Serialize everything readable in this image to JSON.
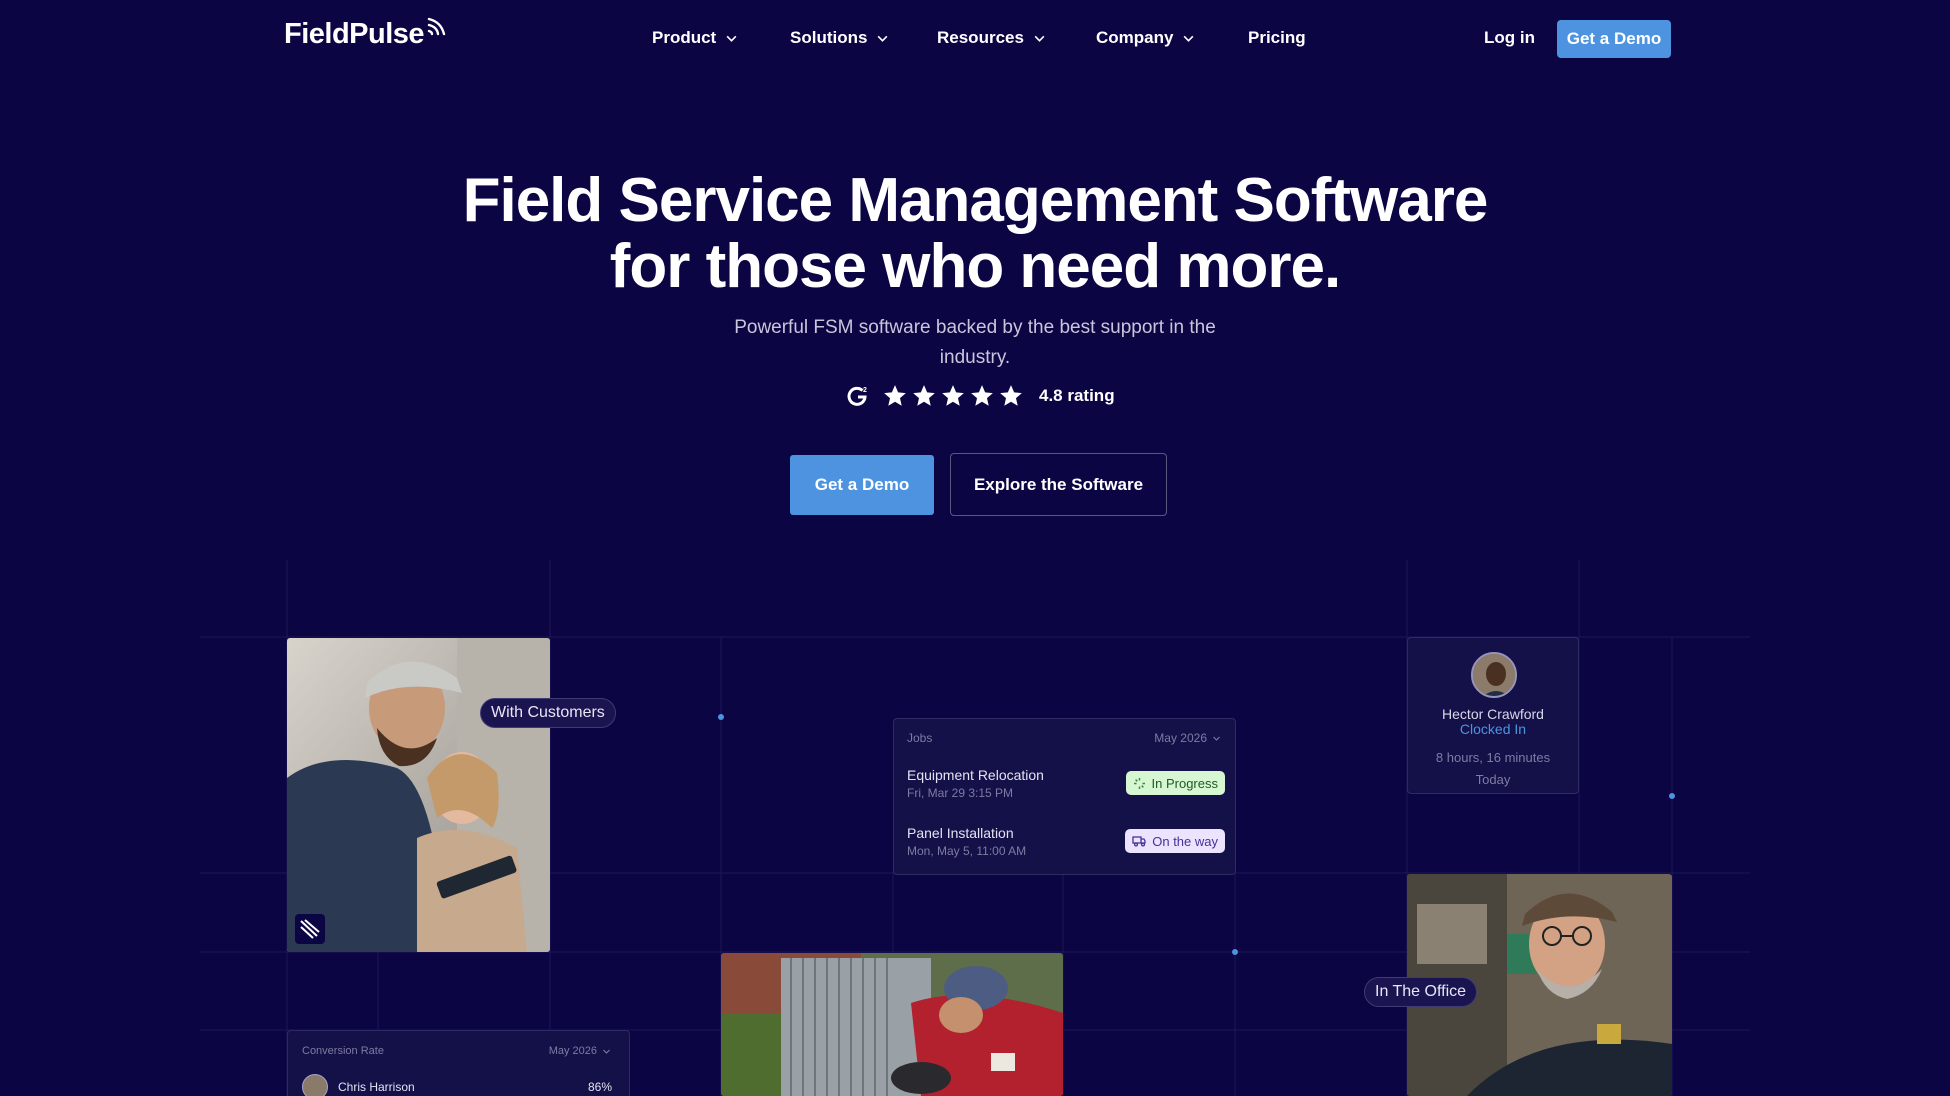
{
  "nav": {
    "logo": "FieldPulse",
    "items": [
      {
        "label": "Product",
        "has_dropdown": true
      },
      {
        "label": "Solutions",
        "has_dropdown": true
      },
      {
        "label": "Resources",
        "has_dropdown": true
      },
      {
        "label": "Company",
        "has_dropdown": true
      },
      {
        "label": "Pricing",
        "has_dropdown": false
      }
    ],
    "login": "Log in",
    "cta": "Get a Demo"
  },
  "hero": {
    "title_line1": "Field Service Management Software",
    "title_line2": "for those who need more.",
    "subtitle": "Powerful FSM software backed by the best support in the industry.",
    "rating_icon": "g2-icon",
    "stars": 5,
    "rating_text": "4.8 rating",
    "primary_cta": "Get a Demo",
    "secondary_cta": "Explore the Software"
  },
  "cards": {
    "with_customers": "With Customers",
    "in_office": "In The Office",
    "jobs": {
      "title": "Jobs",
      "period": "May 2026",
      "items": [
        {
          "title": "Equipment Relocation",
          "time": "Fri, Mar 29 3:15 PM",
          "status": "In Progress",
          "status_color": "#d7f6d2"
        },
        {
          "title": "Panel Installation",
          "time": "Mon, May 5, 11:00 AM",
          "status": "On the way",
          "status_color": "#ece3ff"
        }
      ]
    },
    "timeclock": {
      "name": "Hector Crawford",
      "status": "Clocked In",
      "duration": "8 hours, 16 minutes",
      "day": "Today"
    },
    "conversion": {
      "title": "Conversion Rate",
      "period": "May 2026",
      "rows": [
        {
          "name": "Chris Harrison",
          "value": "86%"
        }
      ]
    }
  },
  "colors": {
    "background": "#0b0543",
    "accent": "#4e93e0",
    "grid_line": "#1f1a5a"
  }
}
